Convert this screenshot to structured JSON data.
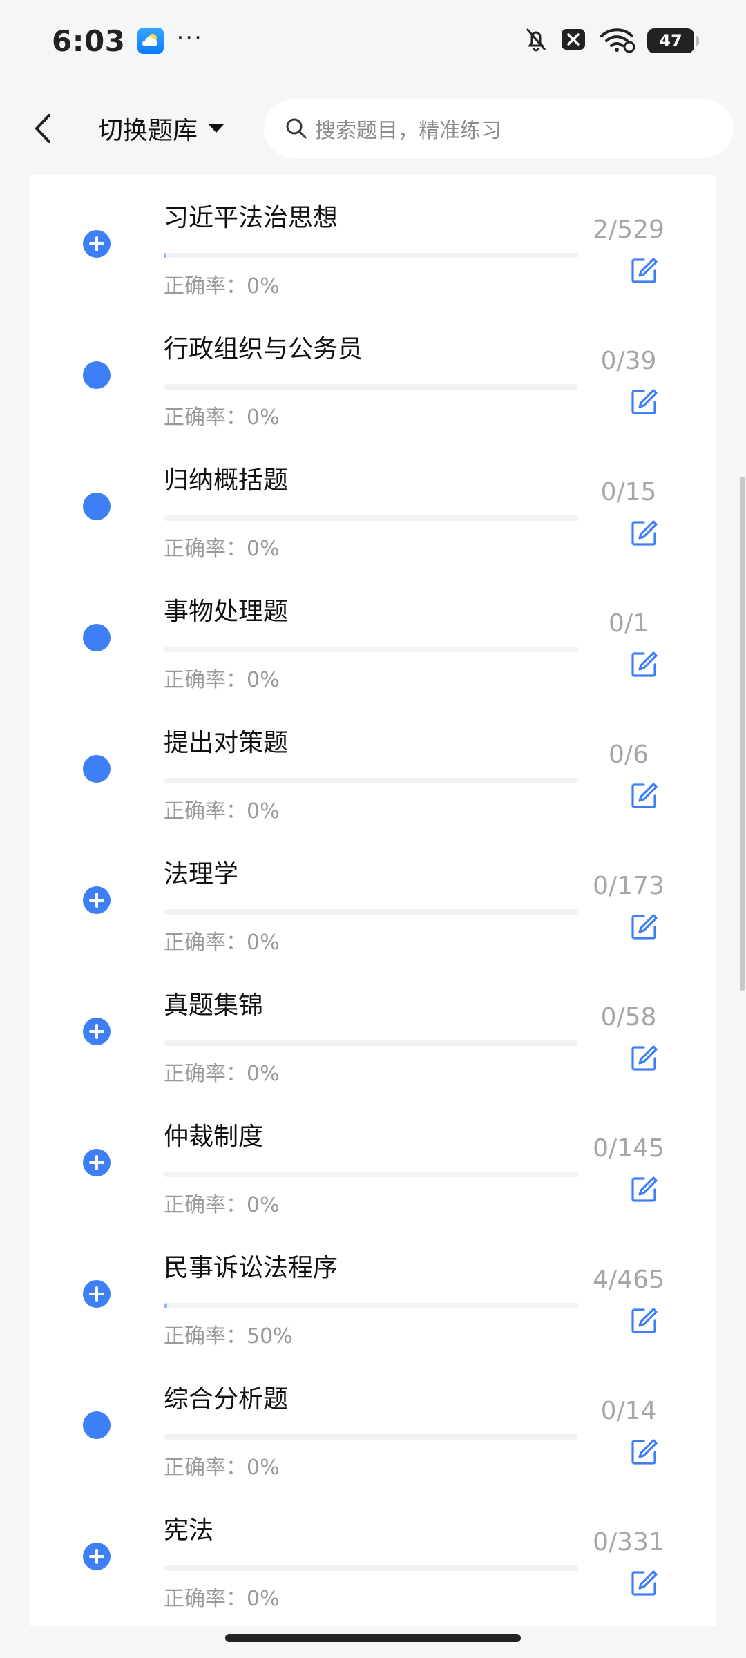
{
  "status_bar": {
    "time": "6:03",
    "more": "···",
    "battery": "47"
  },
  "header": {
    "bank_switch_label": "切换题库",
    "search_placeholder": "搜索题目，精准练习"
  },
  "list": {
    "items": [
      {
        "title": "习近平法治思想",
        "accuracy": "正确率：0%",
        "count": "2/529",
        "expandable": true,
        "progress": 0.004
      },
      {
        "title": "行政组织与公务员",
        "accuracy": "正确率：0%",
        "count": "0/39",
        "expandable": false,
        "progress": 0
      },
      {
        "title": "归纳概括题",
        "accuracy": "正确率：0%",
        "count": "0/15",
        "expandable": false,
        "progress": 0
      },
      {
        "title": "事物处理题",
        "accuracy": "正确率：0%",
        "count": "0/1",
        "expandable": false,
        "progress": 0
      },
      {
        "title": "提出对策题",
        "accuracy": "正确率：0%",
        "count": "0/6",
        "expandable": false,
        "progress": 0
      },
      {
        "title": "法理学",
        "accuracy": "正确率：0%",
        "count": "0/173",
        "expandable": true,
        "progress": 0
      },
      {
        "title": "真题集锦",
        "accuracy": "正确率：0%",
        "count": "0/58",
        "expandable": true,
        "progress": 0
      },
      {
        "title": "仲裁制度",
        "accuracy": "正确率：0%",
        "count": "0/145",
        "expandable": true,
        "progress": 0
      },
      {
        "title": "民事诉讼法程序",
        "accuracy": "正确率：50%",
        "count": "4/465",
        "expandable": true,
        "progress": 0.009
      },
      {
        "title": "综合分析题",
        "accuracy": "正确率：0%",
        "count": "0/14",
        "expandable": false,
        "progress": 0
      },
      {
        "title": "宪法",
        "accuracy": "正确率：0%",
        "count": "0/331",
        "expandable": true,
        "progress": 0
      }
    ]
  },
  "colors": {
    "accent": "#3f7ff5",
    "progress_fill": "#8fb5f8",
    "count_text": "#a6a6a6",
    "accuracy_text": "#9a9a9a"
  }
}
